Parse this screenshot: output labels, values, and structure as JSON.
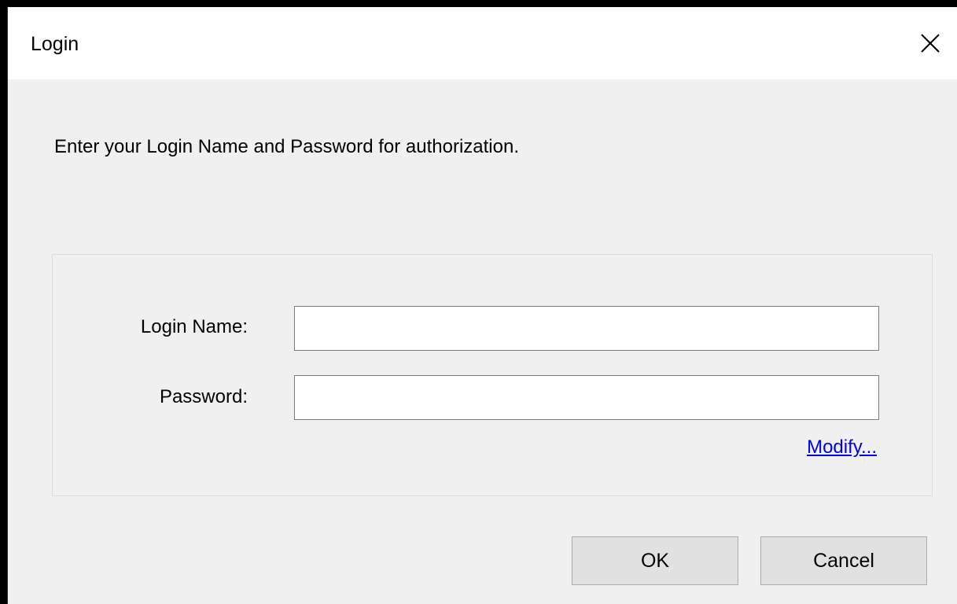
{
  "window": {
    "title": "Login"
  },
  "instruction": "Enter your Login Name and Password for authorization.",
  "form": {
    "login_name_label": "Login Name:",
    "login_name_value": "",
    "password_label": "Password:",
    "password_value": "",
    "modify_link": "Modify..."
  },
  "buttons": {
    "ok_label": "OK",
    "cancel_label": "Cancel"
  },
  "icons": {
    "close": "close-icon"
  },
  "colors": {
    "titlebar_bg": "#ffffff",
    "dialog_bg": "#f0f0f0",
    "link": "#0000ee",
    "button_bg": "#e1e1e1"
  }
}
